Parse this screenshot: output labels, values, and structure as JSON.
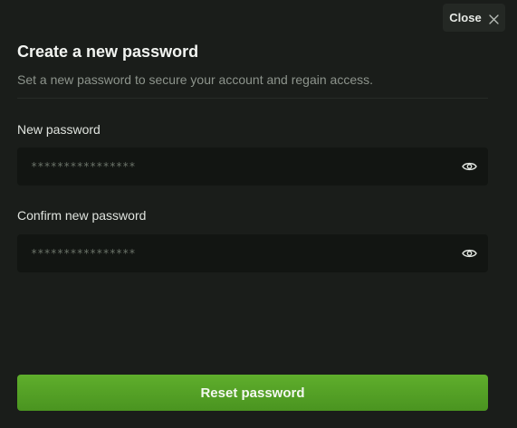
{
  "dialog": {
    "close_label": "Close",
    "title": "Create a new password",
    "subtitle": "Set a new password to secure your account and regain access."
  },
  "fields": {
    "new_password": {
      "label": "New password",
      "placeholder": "****************"
    },
    "confirm_password": {
      "label": "Confirm new password",
      "placeholder": "****************"
    }
  },
  "actions": {
    "submit_label": "Reset password"
  },
  "icons": {
    "close": "close-icon",
    "visibility": "eye-icon"
  },
  "colors": {
    "background": "#1a1d1a",
    "input_background": "#121512",
    "accent": "#52a024"
  }
}
